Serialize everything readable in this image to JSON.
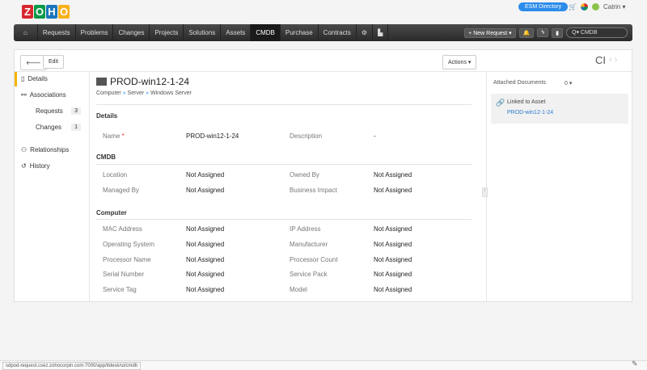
{
  "logo": "ZOHO",
  "top": {
    "esm": "ESM Directory",
    "user": "Catrin"
  },
  "nav": {
    "items": [
      "Requests",
      "Problems",
      "Changes",
      "Projects",
      "Solutions",
      "Assets",
      "CMDB",
      "Purchase",
      "Contracts"
    ],
    "active": "CMDB",
    "new_request": "+ New Request",
    "search": "CMDB"
  },
  "toolbar": {
    "edit": "Edit",
    "actions": "Actions",
    "ci": "CI"
  },
  "sidebar": {
    "details": "Details",
    "associations": "Associations",
    "requests": "Requests",
    "requests_count": "3",
    "changes": "Changes",
    "changes_count": "1",
    "relationships": "Relationships",
    "history": "History"
  },
  "ci": {
    "title": "PROD-win12-1-24",
    "breadcrumb": [
      "Computer",
      "Server",
      "Windows Server"
    ]
  },
  "sections": {
    "details": {
      "title": "Details",
      "name_label": "Name",
      "name_value": "PROD-win12-1-24",
      "desc_label": "Description",
      "desc_value": "-"
    },
    "cmdb": {
      "title": "CMDB",
      "rows": [
        [
          "Location",
          "Not Assigned",
          "Owned By",
          "Not Assigned"
        ],
        [
          "Managed By",
          "Not Assigned",
          "Business Impact",
          "Not Assigned"
        ]
      ]
    },
    "computer": {
      "title": "Computer",
      "rows": [
        [
          "MAC Address",
          "Not Assigned",
          "IP Address",
          "Not Assigned"
        ],
        [
          "Operating System",
          "Not Assigned",
          "Manufacturer",
          "Not Assigned"
        ],
        [
          "Processor Name",
          "Not Assigned",
          "Processor Count",
          "Not Assigned"
        ],
        [
          "Serial Number",
          "Not Assigned",
          "Service Pack",
          "Not Assigned"
        ],
        [
          "Service Tag",
          "Not Assigned",
          "Model",
          "Not Assigned"
        ]
      ]
    }
  },
  "right": {
    "attached": "Attached Documents",
    "attached_count": "0",
    "linked": "Linked to Asset",
    "asset": "PROD-win12-1-24"
  },
  "status_url": "sdpod-request.csez.zohocorpin.com:7000/app/itdesk/ui/cmdb"
}
